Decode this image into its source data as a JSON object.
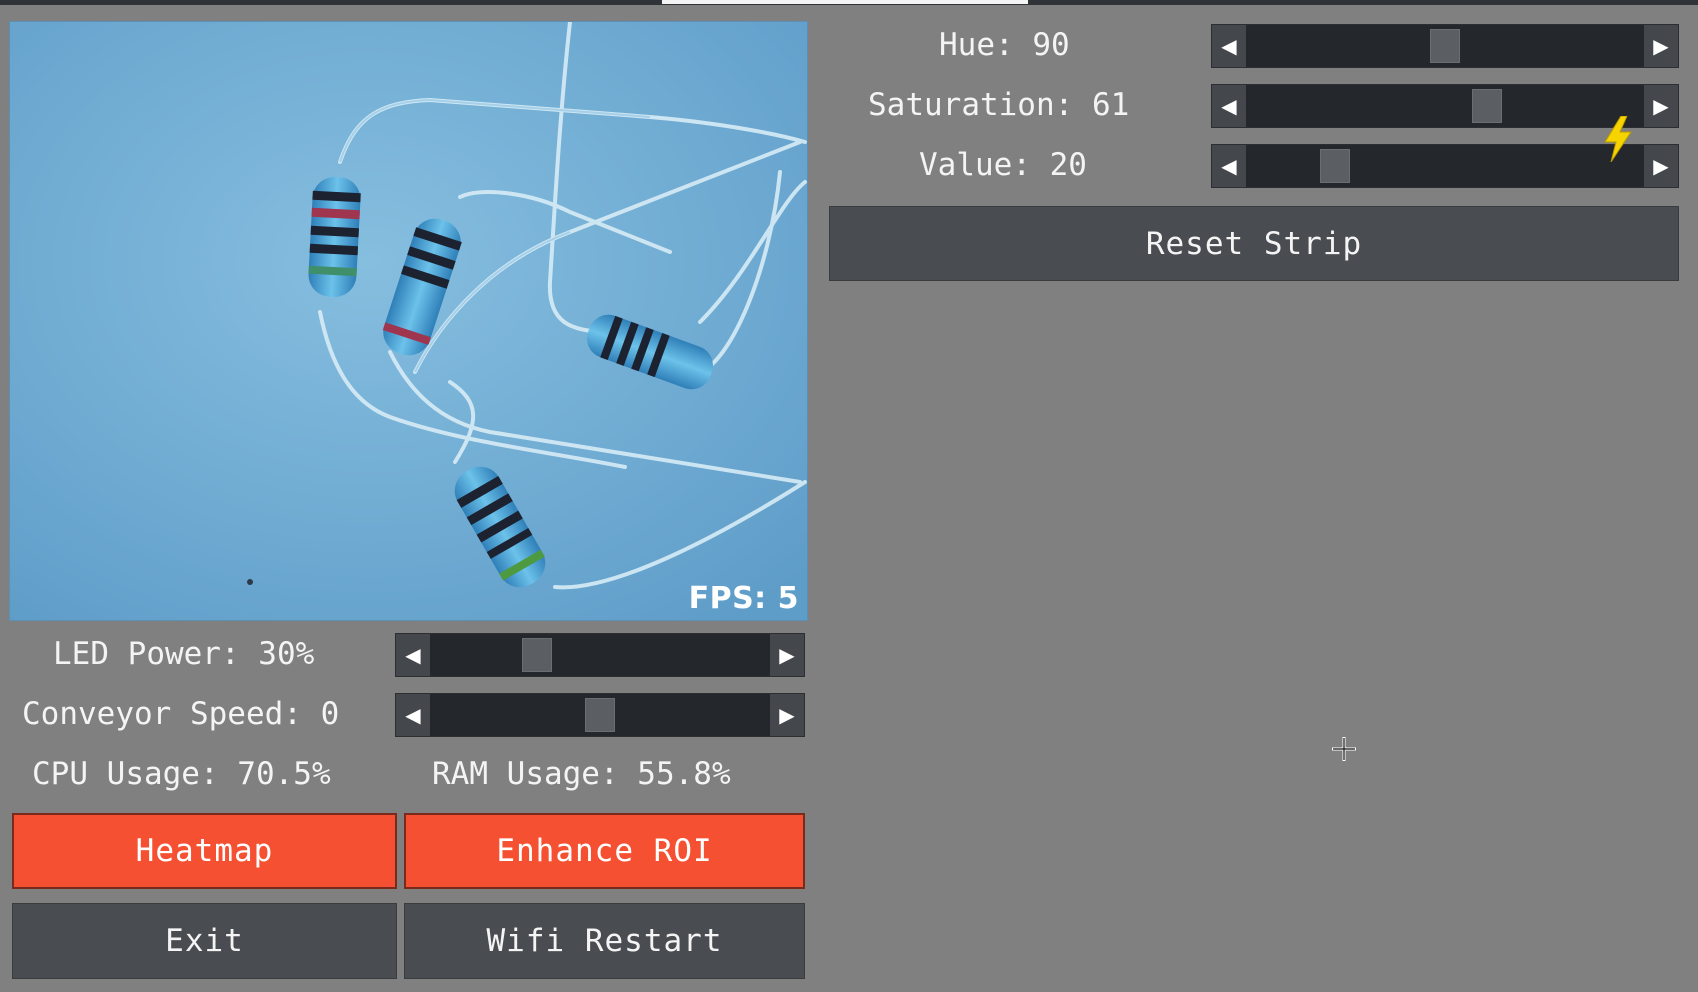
{
  "camera": {
    "fps_label": "FPS: 5"
  },
  "left_panel": {
    "led_power": {
      "label": "LED Power: 30%",
      "value": 30
    },
    "conveyor_speed": {
      "label": "Conveyor Speed: 0",
      "value": 0
    },
    "cpu_usage": "CPU Usage: 70.5%",
    "ram_usage": "RAM Usage: 55.8%",
    "buttons": {
      "heatmap": "Heatmap",
      "enhance_roi": "Enhance ROI",
      "exit": "Exit",
      "wifi_restart": "Wifi Restart"
    }
  },
  "right_panel": {
    "hue": {
      "label": "Hue: 90",
      "value": 90
    },
    "saturation": {
      "label": "Saturation: 61",
      "value": 61
    },
    "value": {
      "label": "Value: 20",
      "value": 20
    },
    "reset_strip": "Reset Strip"
  },
  "icons": {
    "slider_left": "left-arrow-icon",
    "slider_right": "right-arrow-icon",
    "status": "lightning-bolt-icon",
    "cursor": "crosshair-cursor-icon"
  },
  "colors": {
    "background": "#808080",
    "accent_orange": "#f55031",
    "button_dark": "#494c50",
    "slider_track": "#24272b",
    "bolt_yellow": "#f5d400"
  }
}
